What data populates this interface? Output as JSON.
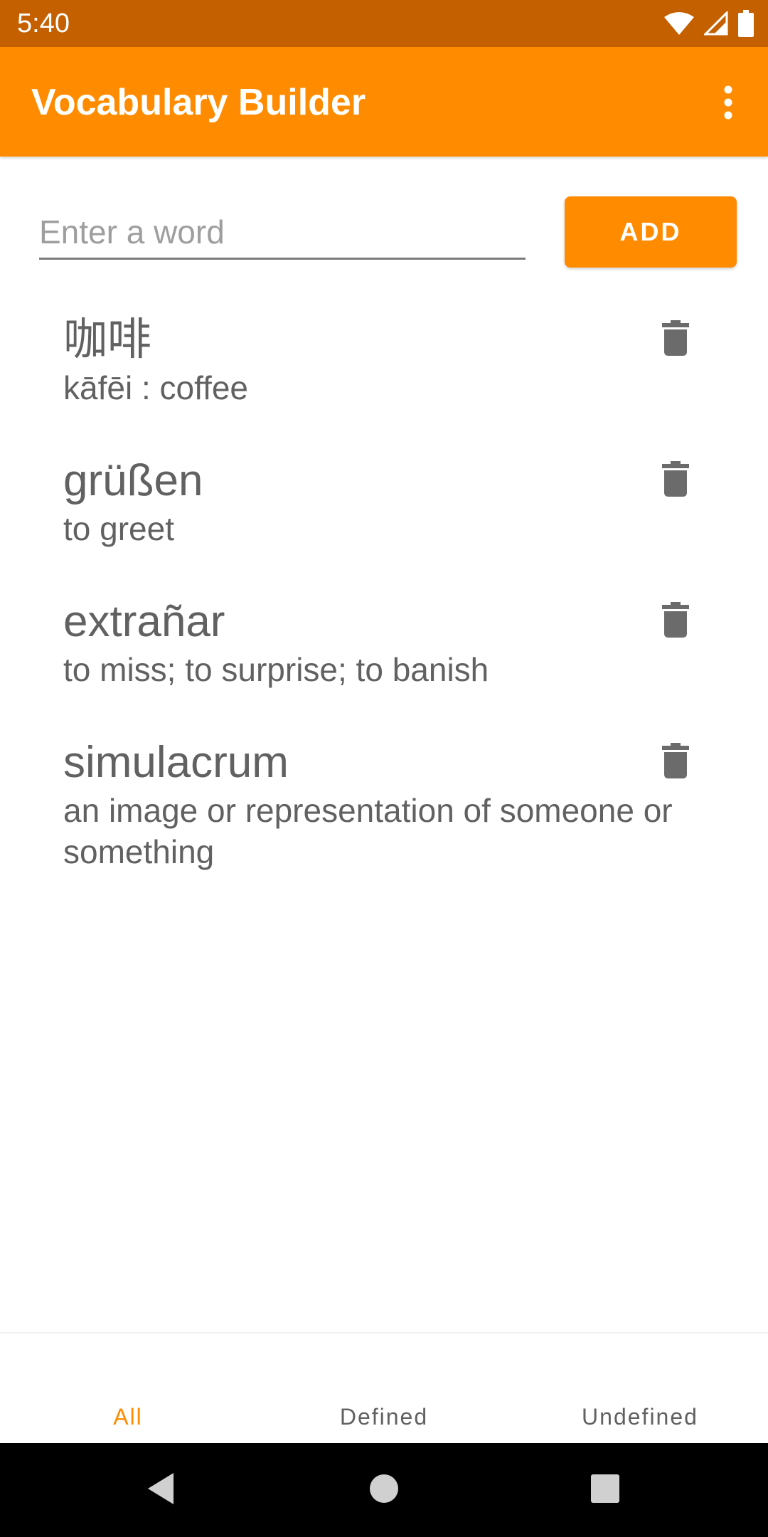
{
  "status_bar": {
    "time": "5:40"
  },
  "app_bar": {
    "title": "Vocabulary Builder"
  },
  "input": {
    "placeholder": "Enter a word",
    "value": ""
  },
  "add_button": {
    "label": "ADD"
  },
  "words": [
    {
      "word": "咖啡",
      "definition": "kāfēi : coffee"
    },
    {
      "word": "grüßen",
      "definition": "to greet"
    },
    {
      "word": "extrañar",
      "definition": "to miss; to surprise; to banish"
    },
    {
      "word": "simulacrum",
      "definition": "an image or representation of someone or something"
    }
  ],
  "tabs": [
    {
      "label": "All",
      "active": true
    },
    {
      "label": "Defined",
      "active": false
    },
    {
      "label": "Undefined",
      "active": false
    }
  ],
  "colors": {
    "accent": "#FF8C00",
    "status_bar": "#C56000",
    "text": "#616161"
  },
  "icons": [
    "wifi-icon",
    "cellular-icon",
    "battery-icon",
    "more-vert-icon",
    "delete-icon",
    "back-icon",
    "home-icon",
    "recents-icon"
  ]
}
